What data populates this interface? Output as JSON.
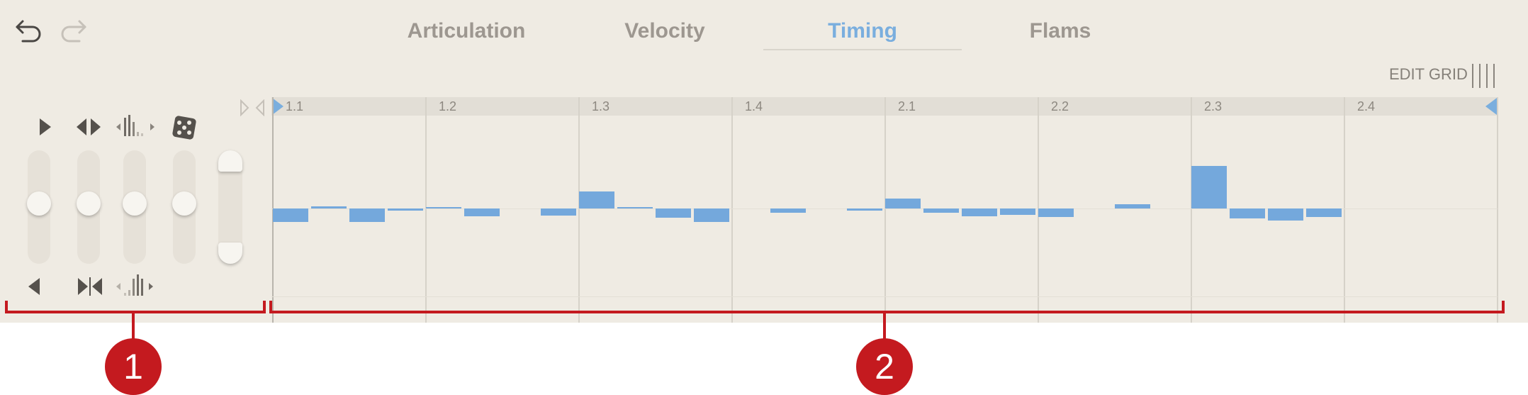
{
  "toolbar": {
    "undo_icon": "undo-icon",
    "redo_icon": "redo-icon"
  },
  "tabs": [
    {
      "label": "Articulation",
      "active": false
    },
    {
      "label": "Velocity",
      "active": false
    },
    {
      "label": "Timing",
      "active": true
    },
    {
      "label": "Flams",
      "active": false
    }
  ],
  "edit_grid": {
    "label": "EDIT GRID"
  },
  "controls": {
    "icons_top": [
      "play-right-icon",
      "stretch-icon",
      "swing-bars-icon",
      "dice-icon"
    ],
    "icons_bottom": [
      "play-left-icon",
      "compress-icon",
      "swing-bars-small-icon"
    ],
    "slider_levels": [
      0.5,
      0.5,
      0.5,
      0.5
    ],
    "range": [
      1.0,
      0.0
    ]
  },
  "ruler": {
    "labels": [
      "1.1",
      "1.2",
      "1.3",
      "1.4",
      "2.1",
      "2.2",
      "2.3",
      "2.4"
    ]
  },
  "colors": {
    "accent": "#74a8dc",
    "active_tab": "#7aaede",
    "annotation": "#c41a1f",
    "background": "#efebe3"
  },
  "steps": [
    -0.32,
    0.05,
    -0.32,
    -0.05,
    0.02,
    -0.18,
    0,
    -0.16,
    0.4,
    0.02,
    -0.22,
    -0.32,
    0,
    -0.1,
    0,
    -0.05,
    0.24,
    -0.1,
    -0.18,
    -0.15,
    -0.2,
    0,
    0.1,
    0,
    1.0,
    -0.24,
    -0.28,
    -0.2,
    0,
    0,
    0,
    0
  ],
  "callouts": [
    "1",
    "2"
  ]
}
